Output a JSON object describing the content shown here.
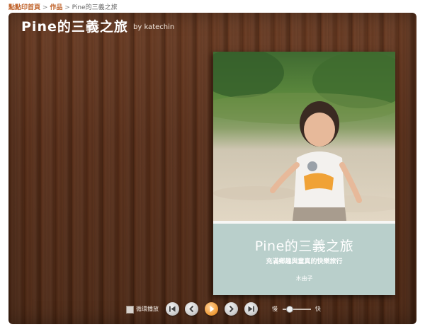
{
  "breadcrumb": {
    "home": "點點印首頁",
    "separator": ">",
    "works": "作品",
    "current": "Pine的三義之旅"
  },
  "viewer": {
    "title": "Pine的三義之旅",
    "author": "by katechin"
  },
  "book": {
    "title": "Pine的三義之旅",
    "subtitle": "充滿鄉趣與童真的快樂旅行",
    "author": "木由子",
    "band_color": "#b9cfcb"
  },
  "controls": {
    "loop_label": "循環播放",
    "loop_checked": false,
    "speed_slow_label": "慢",
    "speed_fast_label": "快",
    "speed_level": 0.25,
    "buttons": [
      "first-page-icon",
      "prev-page-icon",
      "play-icon",
      "next-page-icon",
      "last-page-icon"
    ]
  },
  "colors": {
    "link": "#c0622a",
    "play_accent": "#f2a141",
    "wood": "#5a301a"
  }
}
